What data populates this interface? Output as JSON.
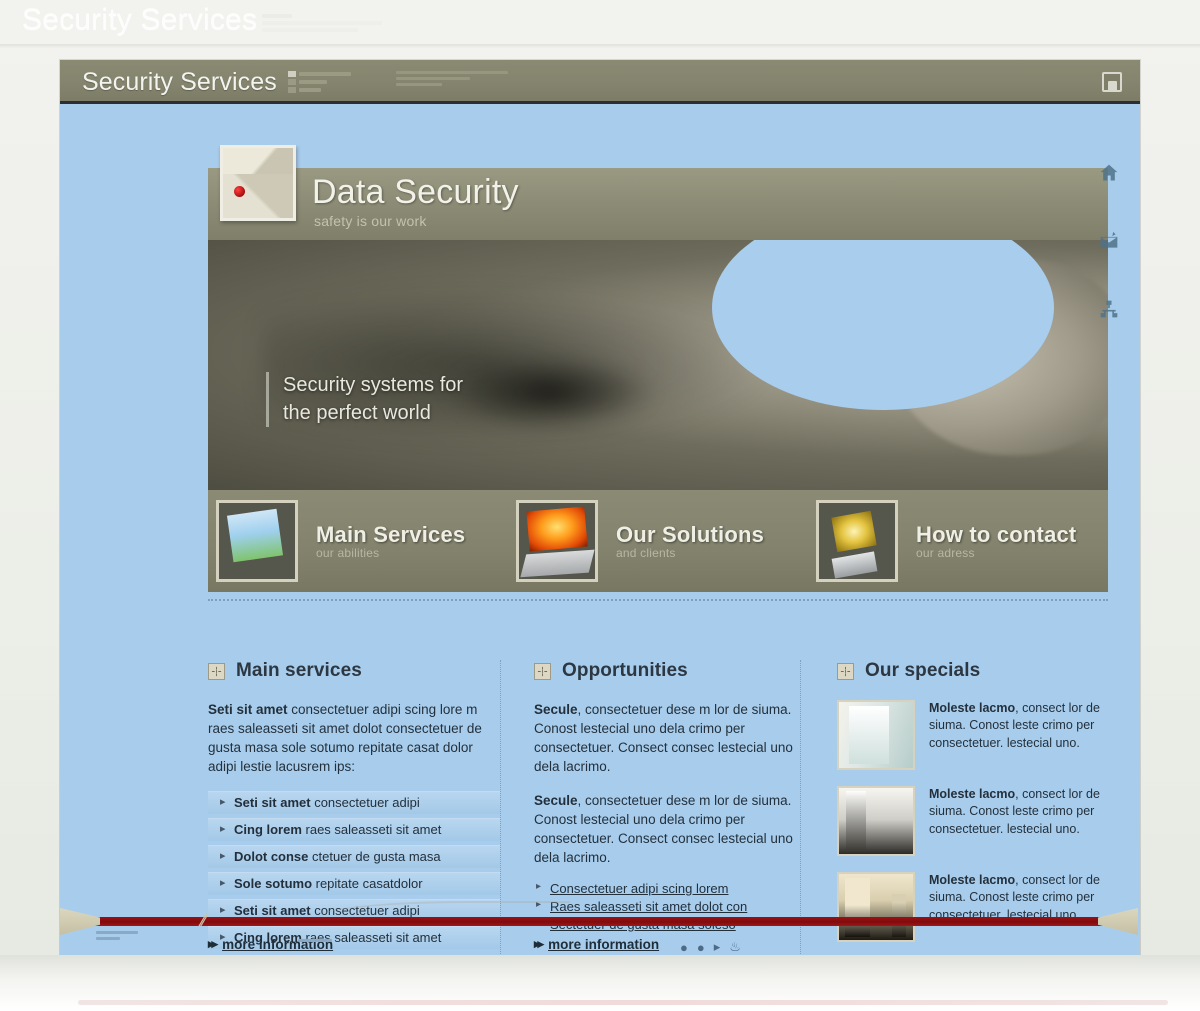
{
  "os": {
    "ghost_title": "Security Services"
  },
  "window": {
    "title": "Security Services",
    "restore_button": "restore-window"
  },
  "hero": {
    "title": "Data Security",
    "subtitle": "safety is our work",
    "tagline_line1": "Security systems for",
    "tagline_line2": "the perfect world",
    "services": [
      {
        "name": "Main Services",
        "sub": "our abilities",
        "thumb": "pda-device"
      },
      {
        "name": "Our Solutions",
        "sub": "and clients",
        "thumb": "laptop-device"
      },
      {
        "name": "How to contact",
        "sub": "our adress",
        "thumb": "cellphone-device"
      }
    ]
  },
  "rail": {
    "items": [
      {
        "icon": "home-icon"
      },
      {
        "icon": "mail-icon"
      },
      {
        "icon": "sitemap-icon"
      }
    ]
  },
  "columns": {
    "main_services": {
      "heading": "Main services",
      "icon": "grid-box-icon",
      "paragraph_bold": "Seti sit amet",
      "paragraph_rest": " consectetuer adipi scing lore m raes saleasseti sit amet dolot consectetuer de gusta masa sole sotumo repitate casat dolor adipi lestie lacusrem ips:",
      "items": [
        {
          "bold": "Seti sit amet",
          "rest": " consectetuer adipi"
        },
        {
          "bold": "Cing lorem",
          "rest": " raes saleasseti sit amet"
        },
        {
          "bold": "Dolot conse",
          "rest": " ctetuer de gusta masa"
        },
        {
          "bold": "Sole sotumo",
          "rest": " repitate casatdolor"
        },
        {
          "bold": "Seti sit amet",
          "rest": " consectetuer adipi"
        },
        {
          "bold": "Cing lorem",
          "rest": " raes saleasseti sit amet"
        }
      ],
      "more_label": "more information"
    },
    "opportunities": {
      "heading": "Opportunities",
      "icon": "grid-box-icon",
      "paragraphs": [
        {
          "bold": "Secule",
          "rest": ", consectetuer dese m lor de siuma. Conost lestecial uno dela crimo per consectetuer. Consect consec lestecial uno dela lacrimo."
        },
        {
          "bold": "Secule",
          "rest": ", consectetuer dese m lor de siuma. Conost lestecial uno dela crimo per consectetuer. Consect consec lestecial uno dela lacrimo."
        }
      ],
      "links": [
        "Consectetuer adipi scing lorem",
        "Raes saleasseti sit amet dolot con",
        "Sectetuer de gusta masa soleso"
      ],
      "more_label": "more information"
    },
    "our_specials": {
      "heading": "Our specials",
      "icon": "grid-box-icon",
      "items": [
        {
          "bold": "Moleste lacmo",
          "rest": ", consect lor de siuma. Conost leste crimo per consectetuer. lestecial uno.",
          "thumb": "window-photo"
        },
        {
          "bold": "Moleste lacmo",
          "rest": ", consect lor de siuma. Conost leste crimo per consectetuer. lestecial uno.",
          "thumb": "door-photo"
        },
        {
          "bold": "Moleste lacmo",
          "rest": ", consect lor de siuma. Conost leste crimo per consectetuer. lestecial uno.",
          "thumb": "corridor-photo"
        }
      ]
    }
  },
  "colors": {
    "page_background": "#a8cdec",
    "bar_olive": "#85856f",
    "accent_red": "#8e0e10",
    "text_dark": "#23303c"
  }
}
